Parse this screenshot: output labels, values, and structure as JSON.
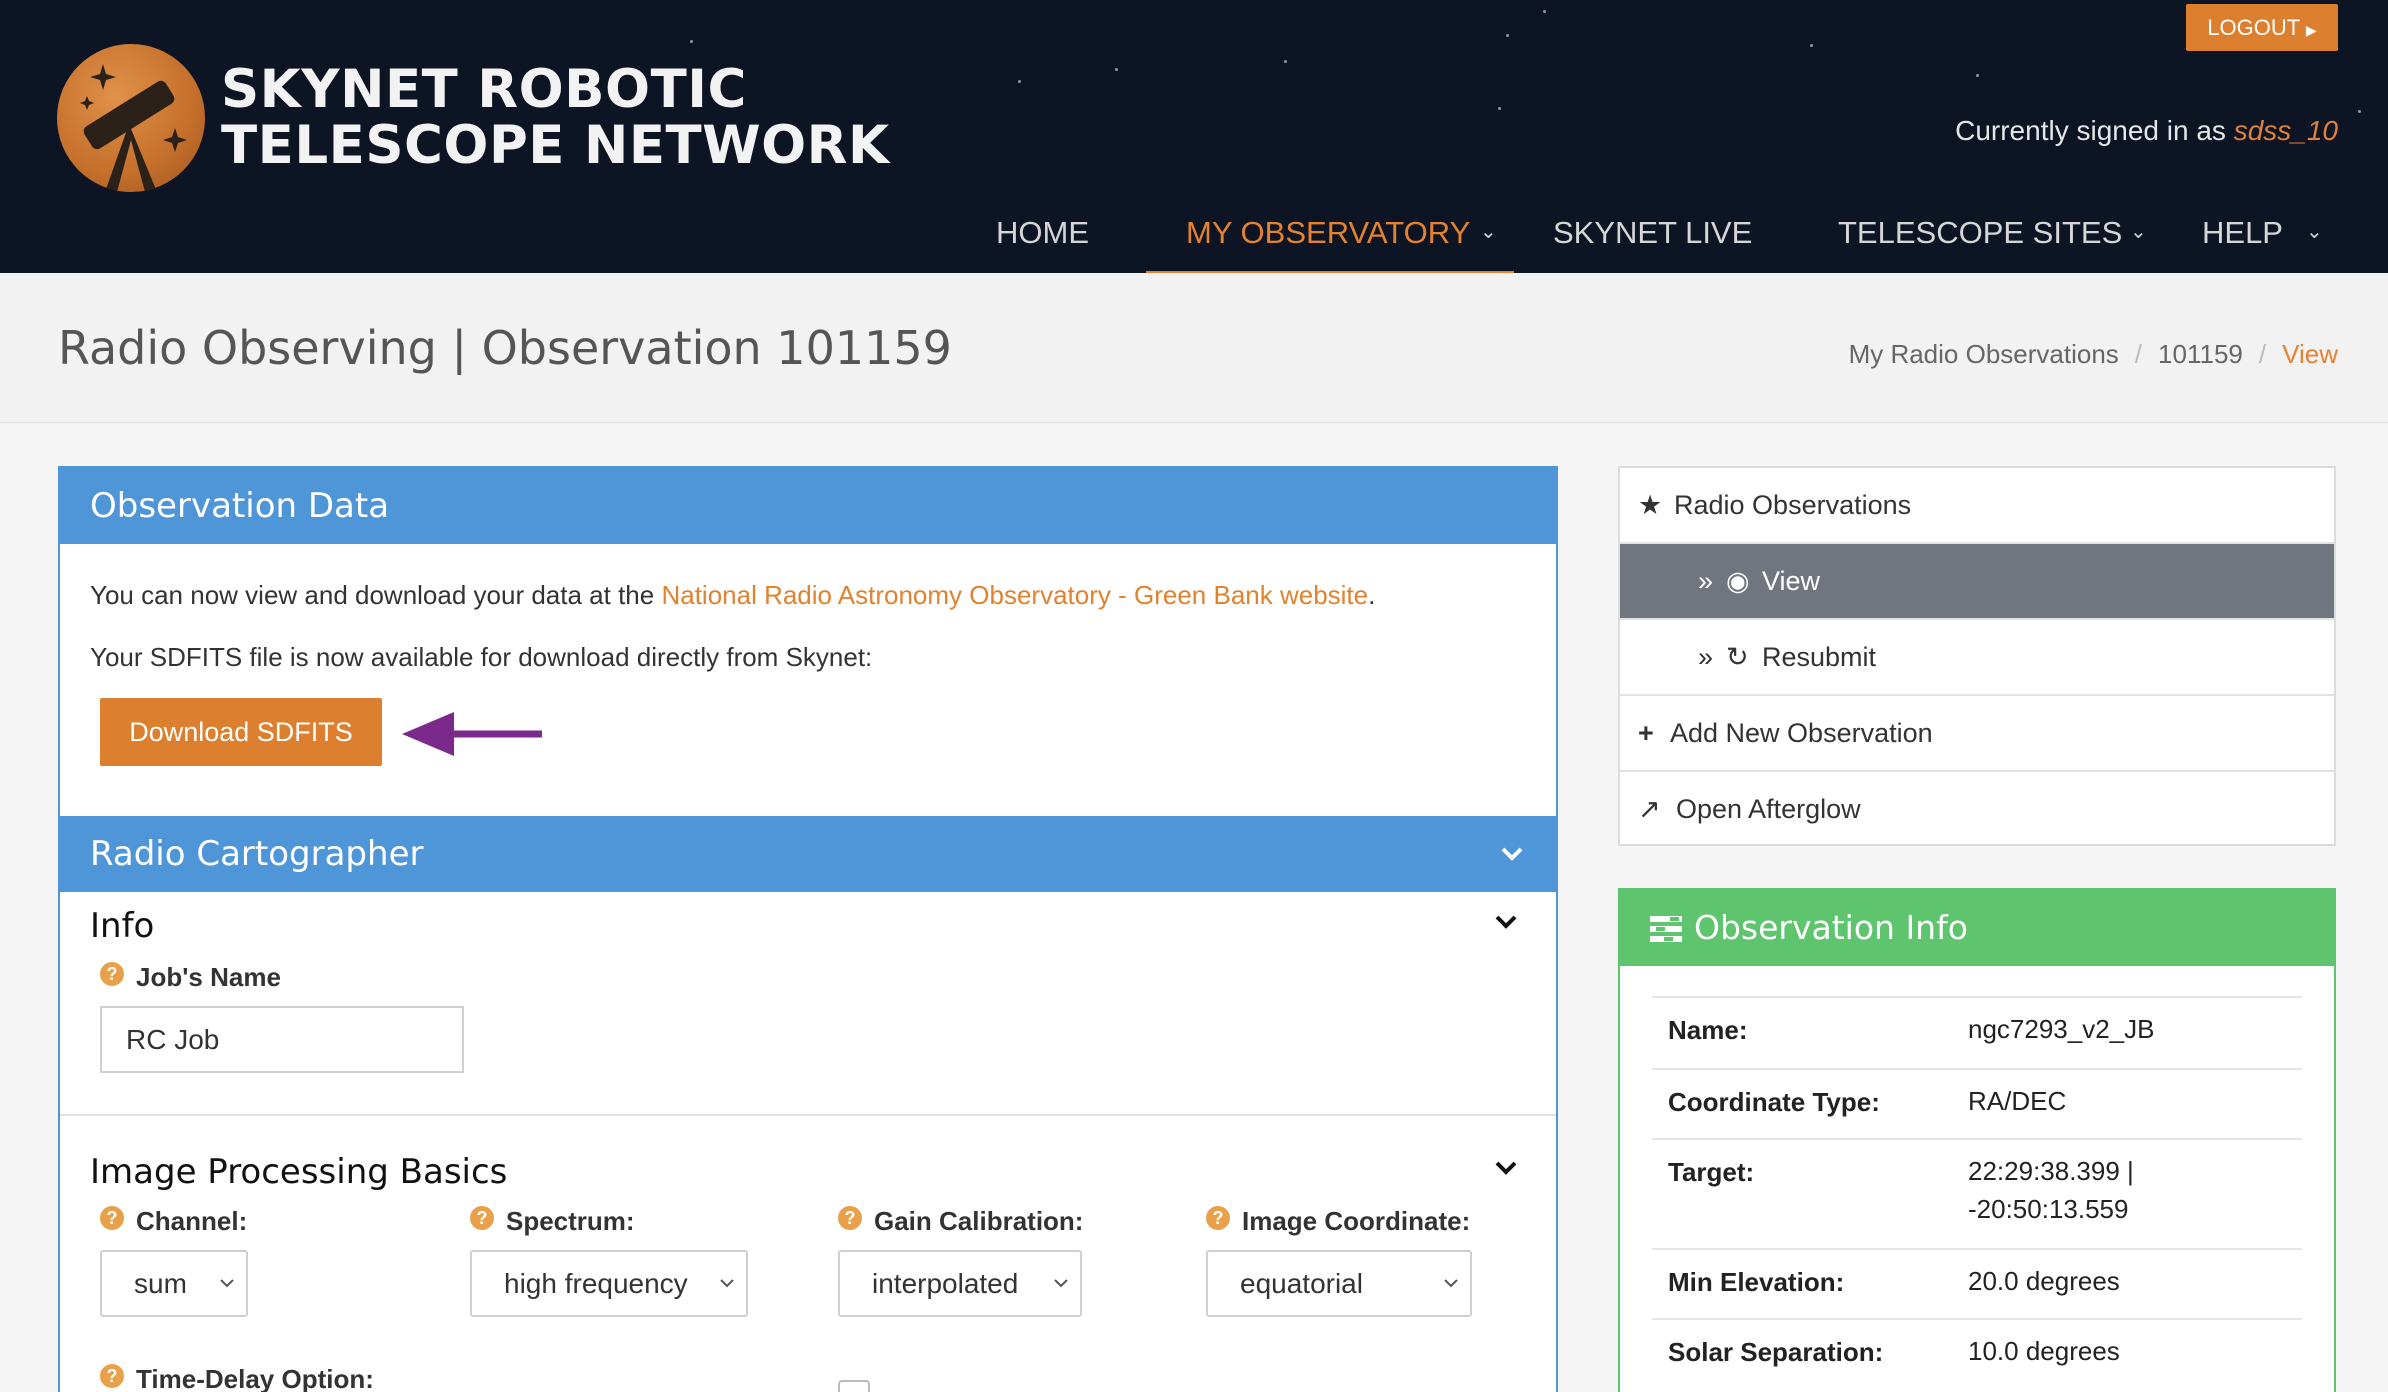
{
  "header": {
    "logo_line1": "SKYNET ROBOTIC",
    "logo_line2": "TELESCOPE NETWORK",
    "logout_label": "LOGOUT",
    "signed_in_prefix": "Currently signed in as",
    "username": "sdss_10",
    "nav": [
      "HOME",
      "MY OBSERVATORY",
      "SKYNET LIVE",
      "TELESCOPE SITES",
      "HELP"
    ],
    "active_nav": "MY OBSERVATORY",
    "accent": "#e5822f"
  },
  "page": {
    "title": "Radio Observing | Observation 101159",
    "breadcrumb": [
      "My Radio Observations",
      "101159",
      "View"
    ]
  },
  "observation_data": {
    "title": "Observation Data",
    "line1_prefix": "You can now view and download your data at the ",
    "line1_link": "National Radio Astronomy Observatory - Green Bank website",
    "line1_suffix": ".",
    "line2": "Your SDFITS file is now available for download directly from Skynet:",
    "download_label": "Download SDFITS"
  },
  "radio_cartographer": {
    "title": "Radio Cartographer",
    "info_title": "Info",
    "job_name_label": "Job's Name",
    "job_name_value": "RC Job",
    "ipb_title": "Image Processing Basics",
    "fields": [
      {
        "label": "Channel:",
        "value": "sum"
      },
      {
        "label": "Spectrum:",
        "value": "high frequency"
      },
      {
        "label": "Gain Calibration:",
        "value": "interpolated"
      },
      {
        "label": "Image Coordinate:",
        "value": "equatorial"
      }
    ],
    "time_delay_label": "Time-Delay Option:"
  },
  "sidebar": {
    "items": [
      {
        "label": "Radio Observations",
        "icon": "star-icon"
      },
      {
        "label": "View",
        "icon": "eye-icon"
      },
      {
        "label": "Resubmit",
        "icon": "refresh-icon"
      },
      {
        "label": "Add New Observation",
        "icon": "plus-icon"
      },
      {
        "label": "Open Afterglow",
        "icon": "external-link-icon"
      }
    ]
  },
  "observation_info": {
    "title": "Observation Info",
    "rows": [
      {
        "key": "Name:",
        "value": "ngc7293_v2_JB"
      },
      {
        "key": "Coordinate Type:",
        "value": "RA/DEC"
      },
      {
        "key": "Target:",
        "value": "22:29:38.399 |",
        "value2": "-20:50:13.559"
      },
      {
        "key": "Min Elevation:",
        "value": "20.0 degrees"
      },
      {
        "key": "Solar Separation:",
        "value": "10.0 degrees"
      }
    ]
  },
  "colors": {
    "header_bg": "#0d1423",
    "panel_blue": "#4f96d9",
    "button_orange": "#dc7f2e",
    "info_green": "#5fc46e",
    "arrow_purple": "#7b2a8c"
  }
}
